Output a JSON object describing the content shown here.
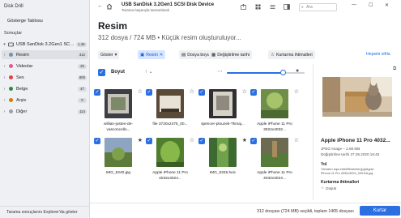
{
  "app": {
    "title": "Disk Drill"
  },
  "sidebar": {
    "dashboard": "Gösterge Tablosu",
    "section": "Sonuçlar",
    "device": {
      "label": "USB SanDisk 3.2Gen1 SCS...",
      "count": "1.4K"
    },
    "items": [
      {
        "label": "Resim",
        "count": "312",
        "icon": "image-icon",
        "active": true,
        "color": "#7c8fa6"
      },
      {
        "label": "Videolar",
        "count": "25",
        "icon": "video-icon",
        "active": false,
        "color": "#e45b8b"
      },
      {
        "label": "Ses",
        "count": "900",
        "icon": "audio-icon",
        "active": false,
        "color": "#e53e3e"
      },
      {
        "label": "Belge",
        "count": "47",
        "icon": "document-icon",
        "active": false,
        "color": "#2b8a3e"
      },
      {
        "label": "Arşiv",
        "count": "9",
        "icon": "archive-icon",
        "active": false,
        "color": "#d97706"
      },
      {
        "label": "Diğer",
        "count": "114",
        "icon": "other-icon",
        "active": false,
        "color": "#9aa0a6"
      }
    ],
    "footer": "Tarama sonuçlarını Explorer'da göster"
  },
  "header": {
    "device_title": "USB SanDisk 3.2Gen1 SCSI Disk Device",
    "device_sub": "Tarama başarıyla tamamlandı",
    "search_placeholder": "Ara"
  },
  "main": {
    "title": "Resim",
    "subtitle": "312 dosya / 724 MB • Küçük resim oluşturuluyor...",
    "filters": [
      {
        "label": "Göster",
        "icon": "chevron-down-icon",
        "active": false
      },
      {
        "label": "Resim",
        "icon": "image-icon",
        "active": true
      },
      {
        "label": "Dosya boyutu",
        "icon": "file-size-icon",
        "active": false
      },
      {
        "label": "Değiştirilme tarihi",
        "icon": "calendar-icon",
        "active": false
      },
      {
        "label": "Kurtarma ihtimalleri",
        "icon": "star-icon",
        "active": false
      }
    ],
    "select_all": "Hepsini sifrla",
    "sort_label": "Boyut"
  },
  "files": [
    {
      "name": "willian-justen-de-vasconcello...",
      "star": "empty"
    },
    {
      "name": "file 3720x2475_00...",
      "star": "empty"
    },
    {
      "name": "spencer-plouzek-Tkmaj...",
      "star": "empty"
    },
    {
      "name": "Apple iPhone 11 Pro 3024x4032...",
      "star": "empty"
    },
    {
      "name": "IMG_6240.jpg",
      "star": "filled"
    },
    {
      "name": "Apple iPhone 11 Pro 4032x3024...",
      "star": "empty"
    },
    {
      "name": "IMG_5325.heic",
      "star": "filled"
    },
    {
      "name": "Apple iPhone 11 Pro 4032x3024...",
      "star": "empty"
    }
  ],
  "preview": {
    "title": "Apple iPhone 11 Pro 4032...",
    "type": "JPEG Image – 2.68 MB",
    "date": "Değiştirilme tarihi 27.05.2020 18:45",
    "path_label": "Yol",
    "path_line1": "\\Yeniden inşa edildi\\Resimler\\jpg\\Apple",
    "path_line2": "iPhone 11 Pro 4032x3024_000116.jpg",
    "chances_label": "Kurtarma ihtimalleri",
    "chances_value": "Düşük"
  },
  "footer": {
    "summary": "312 dosyası (724 MB) seçildi, toplam 1405 dosyası",
    "recover": "Kurtar"
  }
}
